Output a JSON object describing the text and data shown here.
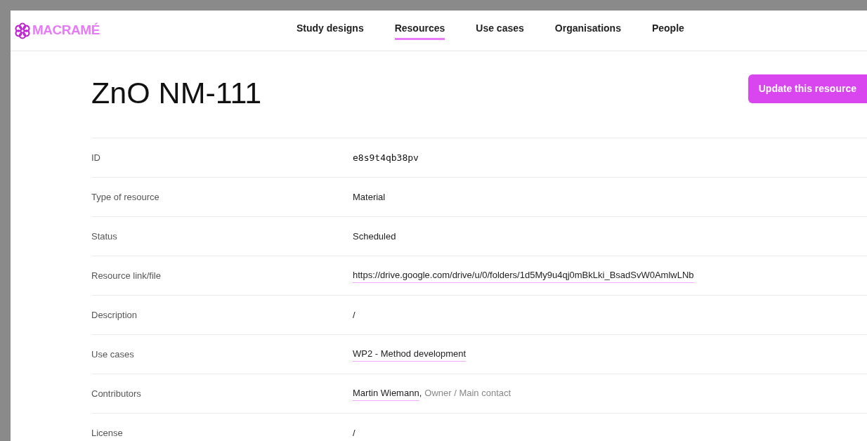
{
  "logo": {
    "text": "MACRAMÉ"
  },
  "nav": [
    {
      "label": "Study designs",
      "selected": false
    },
    {
      "label": "Resources",
      "selected": true
    },
    {
      "label": "Use cases",
      "selected": false
    },
    {
      "label": "Organisations",
      "selected": false
    },
    {
      "label": "People",
      "selected": false
    }
  ],
  "title": "ZnO NM-111",
  "update_button": "Update this resource",
  "fields": [
    {
      "label": "ID",
      "kind": "code",
      "value": "e8s9t4qb38pv"
    },
    {
      "label": "Type of resource",
      "kind": "text",
      "value": "Material"
    },
    {
      "label": "Status",
      "kind": "text",
      "value": "Scheduled"
    },
    {
      "label": "Resource link/file",
      "kind": "link",
      "value": "https://drive.google.com/drive/u/0/folders/1d5My9u4qj0mBkLki_BsadSvW0AmlwLNb"
    },
    {
      "label": "Description",
      "kind": "text",
      "value": "/"
    },
    {
      "label": "Use cases",
      "kind": "link",
      "value": "WP2 - Method development"
    },
    {
      "label": "Contributors",
      "kind": "person",
      "value": "Martin Wiemann",
      "separator": ",",
      "role": "Owner / Main contact"
    },
    {
      "label": "License",
      "kind": "text",
      "value": "/"
    }
  ]
}
